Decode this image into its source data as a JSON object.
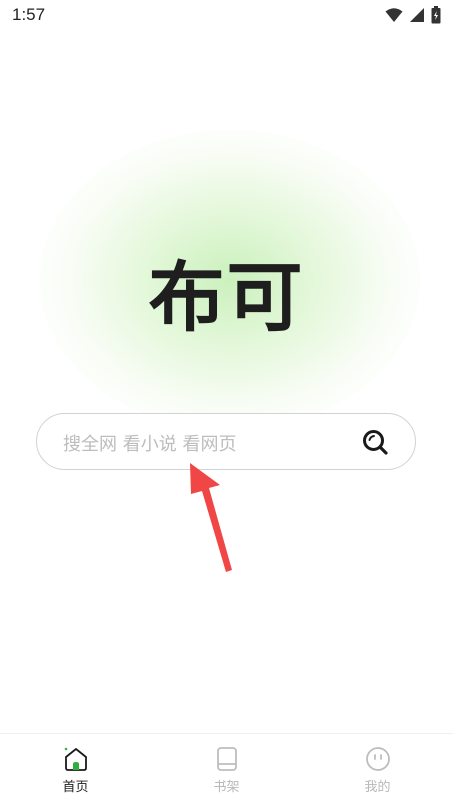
{
  "status_bar": {
    "time": "1:57",
    "icons": [
      "wifi-icon",
      "signal-icon",
      "battery-icon"
    ]
  },
  "app": {
    "logo_text": "布可"
  },
  "search": {
    "placeholder": "搜全网 看小说 看网页"
  },
  "bottom_nav": {
    "items": [
      {
        "label": "首页",
        "icon": "home-icon",
        "active": true
      },
      {
        "label": "书架",
        "icon": "bookshelf-icon",
        "active": false
      },
      {
        "label": "我的",
        "icon": "profile-icon",
        "active": false
      }
    ]
  },
  "colors": {
    "accent": "#1e1e1e",
    "active_green": "#2fae3a",
    "glow_green": "#c8f0b9",
    "arrow_red": "#f04646",
    "inactive": "#b8b8b8"
  }
}
